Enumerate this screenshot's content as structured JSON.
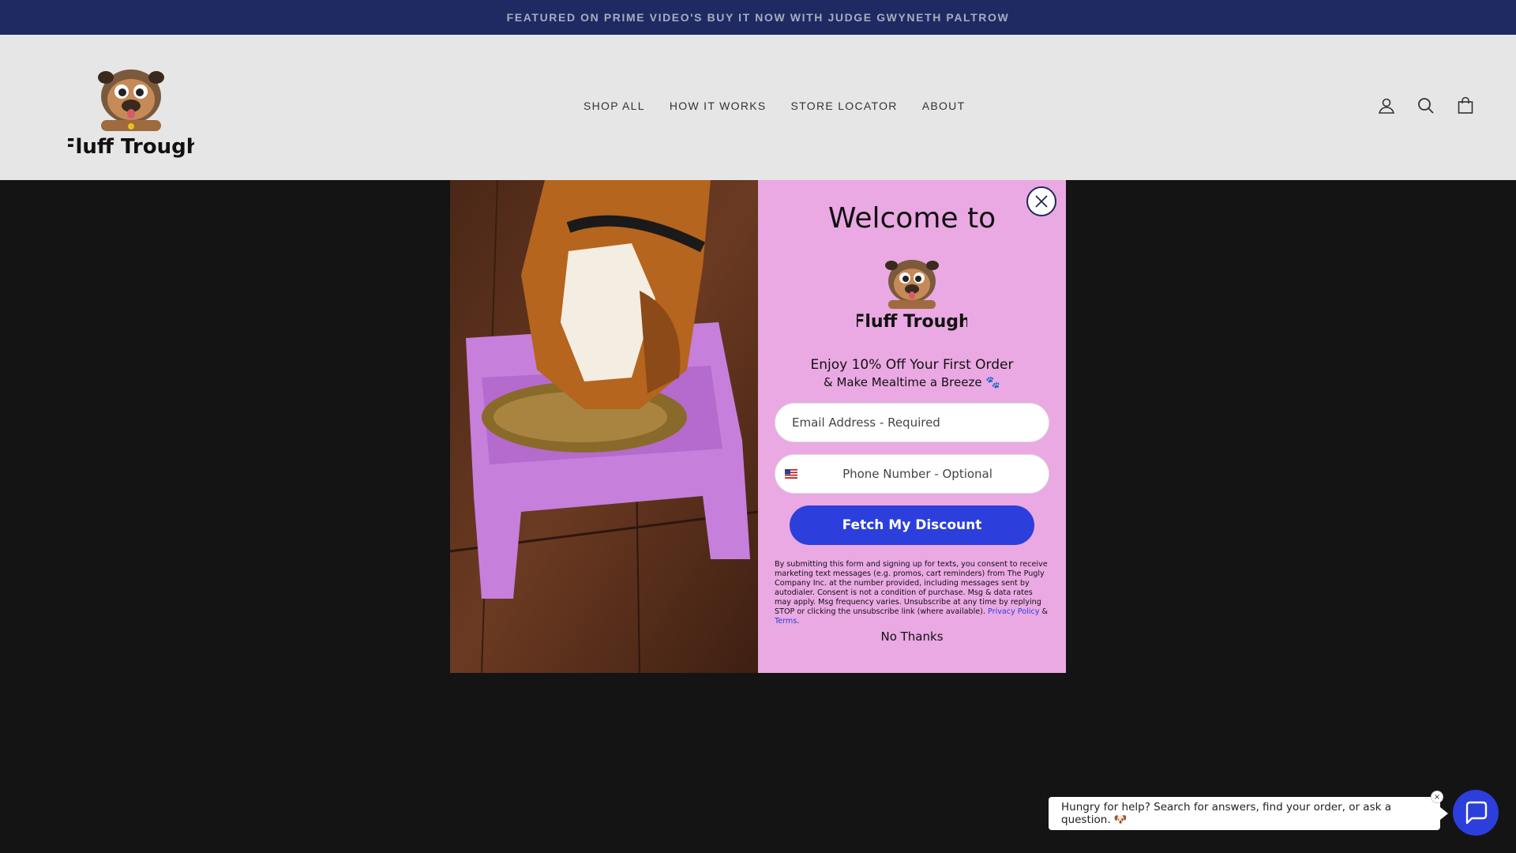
{
  "announcement": {
    "text": "FEATURED ON PRIME VIDEO'S BUY IT NOW WITH JUDGE GWYNETH PALTROW"
  },
  "header": {
    "logo_text": "Fluff Trough",
    "nav": [
      "SHOP ALL",
      "HOW IT WORKS",
      "STORE LOCATOR",
      "ABOUT"
    ],
    "icons": [
      "account-icon",
      "search-icon",
      "cart-icon"
    ]
  },
  "modal": {
    "welcome": "Welcome to",
    "logo_text": "Fluff Trough",
    "offer_line1": "Enjoy 10% Off Your First Order",
    "offer_line2": "& Make Mealtime a Breeze 🐾",
    "email_placeholder": "Email Address - Required",
    "phone_placeholder": "Phone Number - Optional",
    "submit_label": "Fetch My Discount",
    "legal_text": "By submitting this form and signing up for texts, you consent to receive marketing text messages (e.g. promos, cart reminders) from The Pugly Company Inc. at the number provided, including messages sent by autodialer. Consent is not a condition of purchase. Msg & data rates may apply. Msg frequency varies. Unsubscribe at any time by replying STOP or clicking the unsubscribe link (where available).",
    "privacy_label": "Privacy Policy",
    "amp": "&",
    "terms_label": "Terms",
    "period": ".",
    "no_thanks": "No Thanks"
  },
  "chat": {
    "prompt": "Hungry for help? Search for answers, find your order, or ask a question. 🐶",
    "close": "×"
  },
  "colors": {
    "announce_bg": "#1f2a63",
    "form_bg": "#eaa9e3",
    "accent": "#2c3edc"
  }
}
